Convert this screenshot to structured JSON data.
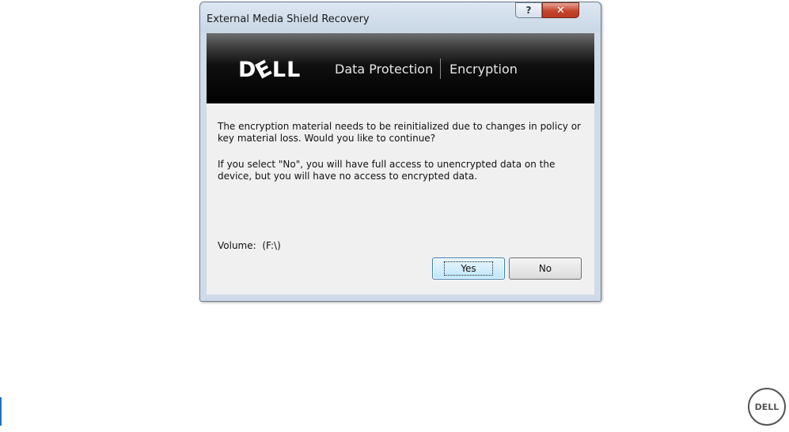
{
  "window": {
    "title": "External Media Shield Recovery",
    "help_label": "?",
    "close_label": "✕"
  },
  "banner": {
    "logo_text": "DELL",
    "tagline_1": "Data Protection",
    "tagline_2": "Encryption"
  },
  "message": {
    "paragraph_1": "The encryption material needs to be reinitialized due to changes in policy or key material loss. Would you like to continue?",
    "paragraph_2": "If you select \"No\", you will have full access to unencrypted data on the device, but you will have no access to encrypted data."
  },
  "volume": {
    "label": "Volume:",
    "value": "(F:\\)"
  },
  "buttons": {
    "yes_label": "Yes",
    "no_label": "No"
  },
  "page": {
    "corner_logo_text": "DELL",
    "accent_color": "#1a73c9"
  }
}
